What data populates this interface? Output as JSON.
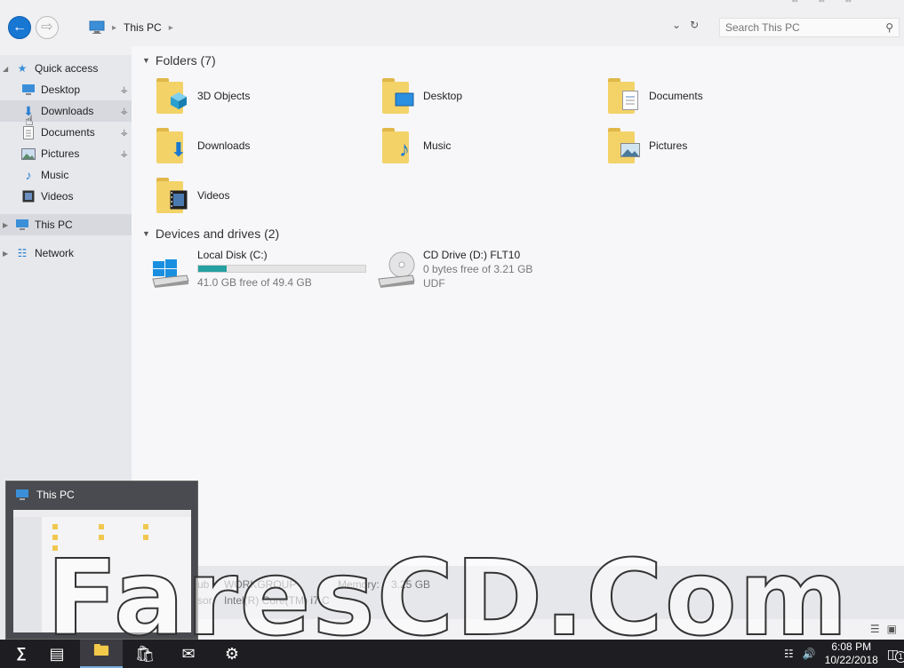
{
  "window": {
    "location": "This PC",
    "search_placeholder": "Search This PC"
  },
  "sidebar": {
    "quick_access": "Quick access",
    "quick_items": [
      {
        "label": "Desktop",
        "icon": "desktop-icon",
        "pinned": true
      },
      {
        "label": "Downloads",
        "icon": "download-icon",
        "pinned": true,
        "selected": true
      },
      {
        "label": "Documents",
        "icon": "document-icon",
        "pinned": true
      },
      {
        "label": "Pictures",
        "icon": "pictures-icon",
        "pinned": true
      },
      {
        "label": "Music",
        "icon": "music-icon",
        "pinned": false
      },
      {
        "label": "Videos",
        "icon": "video-icon",
        "pinned": false
      }
    ],
    "this_pc": "This PC",
    "network": "Network"
  },
  "folders": {
    "heading": "Folders (7)",
    "items": [
      {
        "label": "3D Objects",
        "icon": "3d-objects-icon"
      },
      {
        "label": "Desktop",
        "icon": "desktop-icon"
      },
      {
        "label": "Documents",
        "icon": "document-icon"
      },
      {
        "label": "Downloads",
        "icon": "download-icon"
      },
      {
        "label": "Music",
        "icon": "music-icon"
      },
      {
        "label": "Pictures",
        "icon": "pictures-icon"
      },
      {
        "label": "Videos",
        "icon": "video-icon"
      }
    ]
  },
  "drives": {
    "heading": "Devices and drives (2)",
    "items": [
      {
        "name": "Local Disk (C:)",
        "free": "41.0 GB free of 49.4 GB",
        "used_fraction": 0.17,
        "icon": "windows-drive-icon"
      },
      {
        "name": "CD Drive (D:) FLT10",
        "free": "0 bytes free of 3.21 GB",
        "fs": "UDF",
        "icon": "cd-drive-icon"
      }
    ]
  },
  "details": {
    "workgroup_label": "ub",
    "workgroup": "WORKGROUP",
    "memory_label": "Memory:",
    "memory": "3.25 GB",
    "processor_label": "sor",
    "processor": "Intel(R) Core(TM) i7 C"
  },
  "taskbar": {
    "time": "6:08 PM",
    "date": "10/22/2018",
    "notification_count": "1"
  },
  "thumbnail": {
    "title": "This PC"
  },
  "watermark": "FaresCD.Com",
  "colors": {
    "accent": "#1877d2",
    "drive_bar": "#26a0a0",
    "folder": "#f3d268",
    "taskbar": "#1e1e22"
  }
}
